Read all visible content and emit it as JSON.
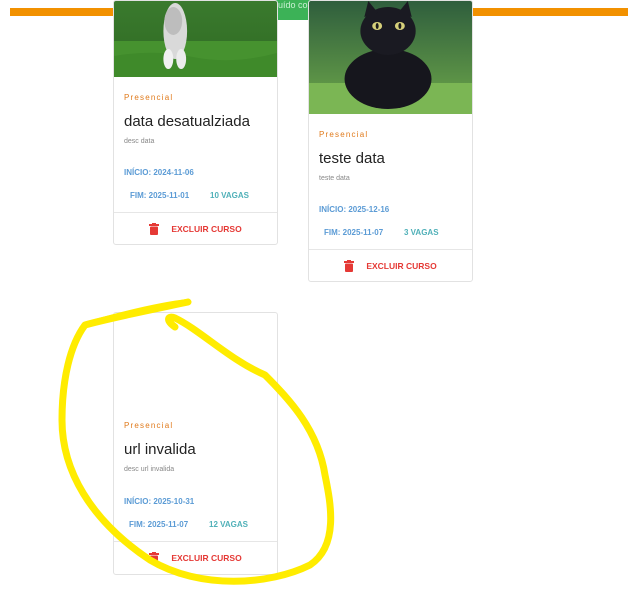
{
  "toast": {
    "message": "Curso excluído com sucesso"
  },
  "courses": [
    {
      "modality": "Presencial",
      "title": "data desatualziada",
      "description": "desc data",
      "start": "INÍCIO: 2024-11-06",
      "end": "FIM: 2025-11-01",
      "slots": "10 VAGAS",
      "delete_label": "EXCLUIR CURSO",
      "image": "cat-photo-gray"
    },
    {
      "modality": "Presencial",
      "title": "teste data",
      "description": "teste data",
      "start": "INÍCIO: 2025-12-16",
      "end": "FIM: 2025-11-07",
      "slots": "3 VAGAS",
      "delete_label": "EXCLUIR CURSO",
      "image": "cat-photo-black"
    },
    {
      "modality": "Presencial",
      "title": "url invalida",
      "description": "desc url invalida",
      "start": "INÍCIO: 2025-10-31",
      "end": "FIM: 2025-11-07",
      "slots": "12 VAGAS",
      "delete_label": "EXCLUIR CURSO",
      "image": "broken-image"
    }
  ],
  "colors": {
    "topbar": "#f29100",
    "toast": "#3cb257",
    "modality": "#e07a1b",
    "date": "#5b9bd5",
    "slots": "#4fb0b8",
    "delete": "#e53935",
    "annotation": "#ffec00"
  },
  "icons": [
    "trash-icon"
  ]
}
